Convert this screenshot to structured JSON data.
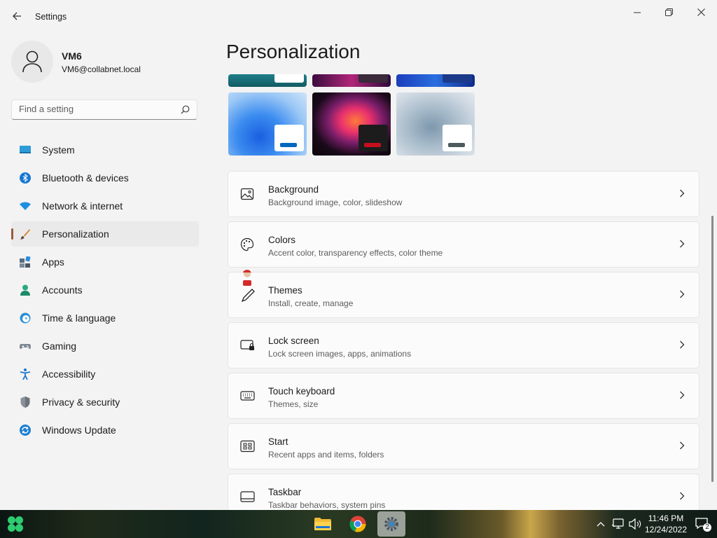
{
  "window": {
    "title": "Settings",
    "back_icon": "back-arrow-icon",
    "controls": [
      "minimize-icon",
      "restore-icon",
      "close-icon"
    ]
  },
  "profile": {
    "name": "VM6",
    "email": "VM6@collabnet.local"
  },
  "search": {
    "placeholder": "Find a setting",
    "value": ""
  },
  "nav": [
    {
      "label": "System",
      "icon": "system-icon",
      "active": false
    },
    {
      "label": "Bluetooth & devices",
      "icon": "bluetooth-icon",
      "active": false
    },
    {
      "label": "Network & internet",
      "icon": "wifi-icon",
      "active": false
    },
    {
      "label": "Personalization",
      "icon": "brush-icon",
      "active": true
    },
    {
      "label": "Apps",
      "icon": "apps-icon",
      "active": false
    },
    {
      "label": "Accounts",
      "icon": "person-icon",
      "active": false
    },
    {
      "label": "Time & language",
      "icon": "globe-clock-icon",
      "active": false
    },
    {
      "label": "Gaming",
      "icon": "gamepad-icon",
      "active": false
    },
    {
      "label": "Accessibility",
      "icon": "accessibility-icon",
      "active": false
    },
    {
      "label": "Privacy & security",
      "icon": "shield-icon",
      "active": false
    },
    {
      "label": "Windows Update",
      "icon": "update-icon",
      "active": false
    }
  ],
  "page": {
    "title": "Personalization"
  },
  "themes": [
    {
      "name": "windows-light-theme",
      "accent": "#0067c0"
    },
    {
      "name": "glow-theme",
      "accent": "#c50f1f"
    },
    {
      "name": "captured-motion-theme",
      "accent": "#4c5a5e"
    }
  ],
  "cards": [
    {
      "title": "Background",
      "subtitle": "Background image, color, slideshow",
      "icon": "image-icon"
    },
    {
      "title": "Colors",
      "subtitle": "Accent color, transparency effects, color theme",
      "icon": "palette-icon"
    },
    {
      "title": "Themes",
      "subtitle": "Install, create, manage",
      "icon": "brush-pen-icon"
    },
    {
      "title": "Lock screen",
      "subtitle": "Lock screen images, apps, animations",
      "icon": "lock-screen-icon"
    },
    {
      "title": "Touch keyboard",
      "subtitle": "Themes, size",
      "icon": "keyboard-icon"
    },
    {
      "title": "Start",
      "subtitle": "Recent apps and items, folders",
      "icon": "start-menu-icon"
    },
    {
      "title": "Taskbar",
      "subtitle": "Taskbar behaviors, system pins",
      "icon": "taskbar-icon"
    }
  ],
  "taskbar": {
    "apps": [
      "file-explorer-icon",
      "chrome-icon",
      "settings-icon"
    ],
    "time": "11:46 PM",
    "date": "12/24/2022",
    "notification_count": "2"
  },
  "colors": {
    "accent": "#0067c0",
    "nav_active_indicator": "#9a5a3a"
  }
}
